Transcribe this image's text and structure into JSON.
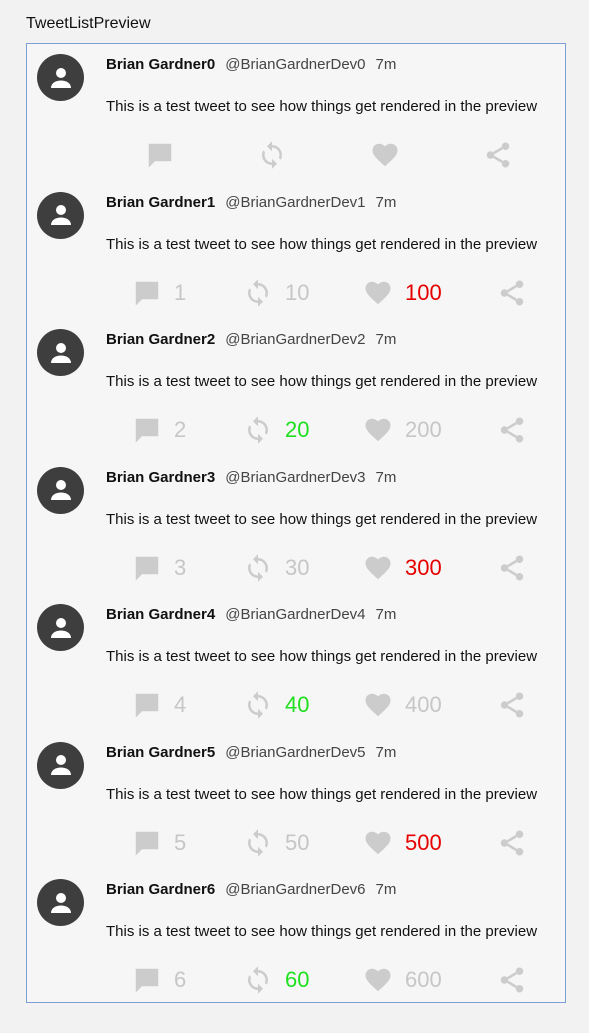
{
  "preview": {
    "title": "TweetListPreview"
  },
  "colors": {
    "icon_gray": "#cccccc",
    "count_gray": "#c6c6c6",
    "red": "#e60000",
    "green": "#1fe01f",
    "avatar": "#3e3e3e"
  },
  "tweets": [
    {
      "name": "Brian Gardner0",
      "handle": "@BrianGardnerDev0",
      "time": "7m",
      "text": "This is a test tweet to see how things get rendered in the preview",
      "comments": "",
      "retweets": "",
      "likes": "",
      "retweet_style": "gray",
      "like_style": "gray"
    },
    {
      "name": "Brian Gardner1",
      "handle": "@BrianGardnerDev1",
      "time": "7m",
      "text": "This is a test tweet to see how things get rendered in the preview",
      "comments": "1",
      "retweets": "10",
      "likes": "100",
      "retweet_style": "gray",
      "like_style": "red"
    },
    {
      "name": "Brian Gardner2",
      "handle": "@BrianGardnerDev2",
      "time": "7m",
      "text": "This is a test tweet to see how things get rendered in the preview",
      "comments": "2",
      "retweets": "20",
      "likes": "200",
      "retweet_style": "green",
      "like_style": "gray"
    },
    {
      "name": "Brian Gardner3",
      "handle": "@BrianGardnerDev3",
      "time": "7m",
      "text": "This is a test tweet to see how things get rendered in the preview",
      "comments": "3",
      "retweets": "30",
      "likes": "300",
      "retweet_style": "gray",
      "like_style": "red"
    },
    {
      "name": "Brian Gardner4",
      "handle": "@BrianGardnerDev4",
      "time": "7m",
      "text": "This is a test tweet to see how things get rendered in the preview",
      "comments": "4",
      "retweets": "40",
      "likes": "400",
      "retweet_style": "green",
      "like_style": "gray"
    },
    {
      "name": "Brian Gardner5",
      "handle": "@BrianGardnerDev5",
      "time": "7m",
      "text": "This is a test tweet to see how things get rendered in the preview",
      "comments": "5",
      "retweets": "50",
      "likes": "500",
      "retweet_style": "gray",
      "like_style": "red"
    },
    {
      "name": "Brian Gardner6",
      "handle": "@BrianGardnerDev6",
      "time": "7m",
      "text": "This is a test tweet to see how things get rendered in the preview",
      "comments": "6",
      "retweets": "60",
      "likes": "600",
      "retweet_style": "green",
      "like_style": "gray"
    }
  ]
}
